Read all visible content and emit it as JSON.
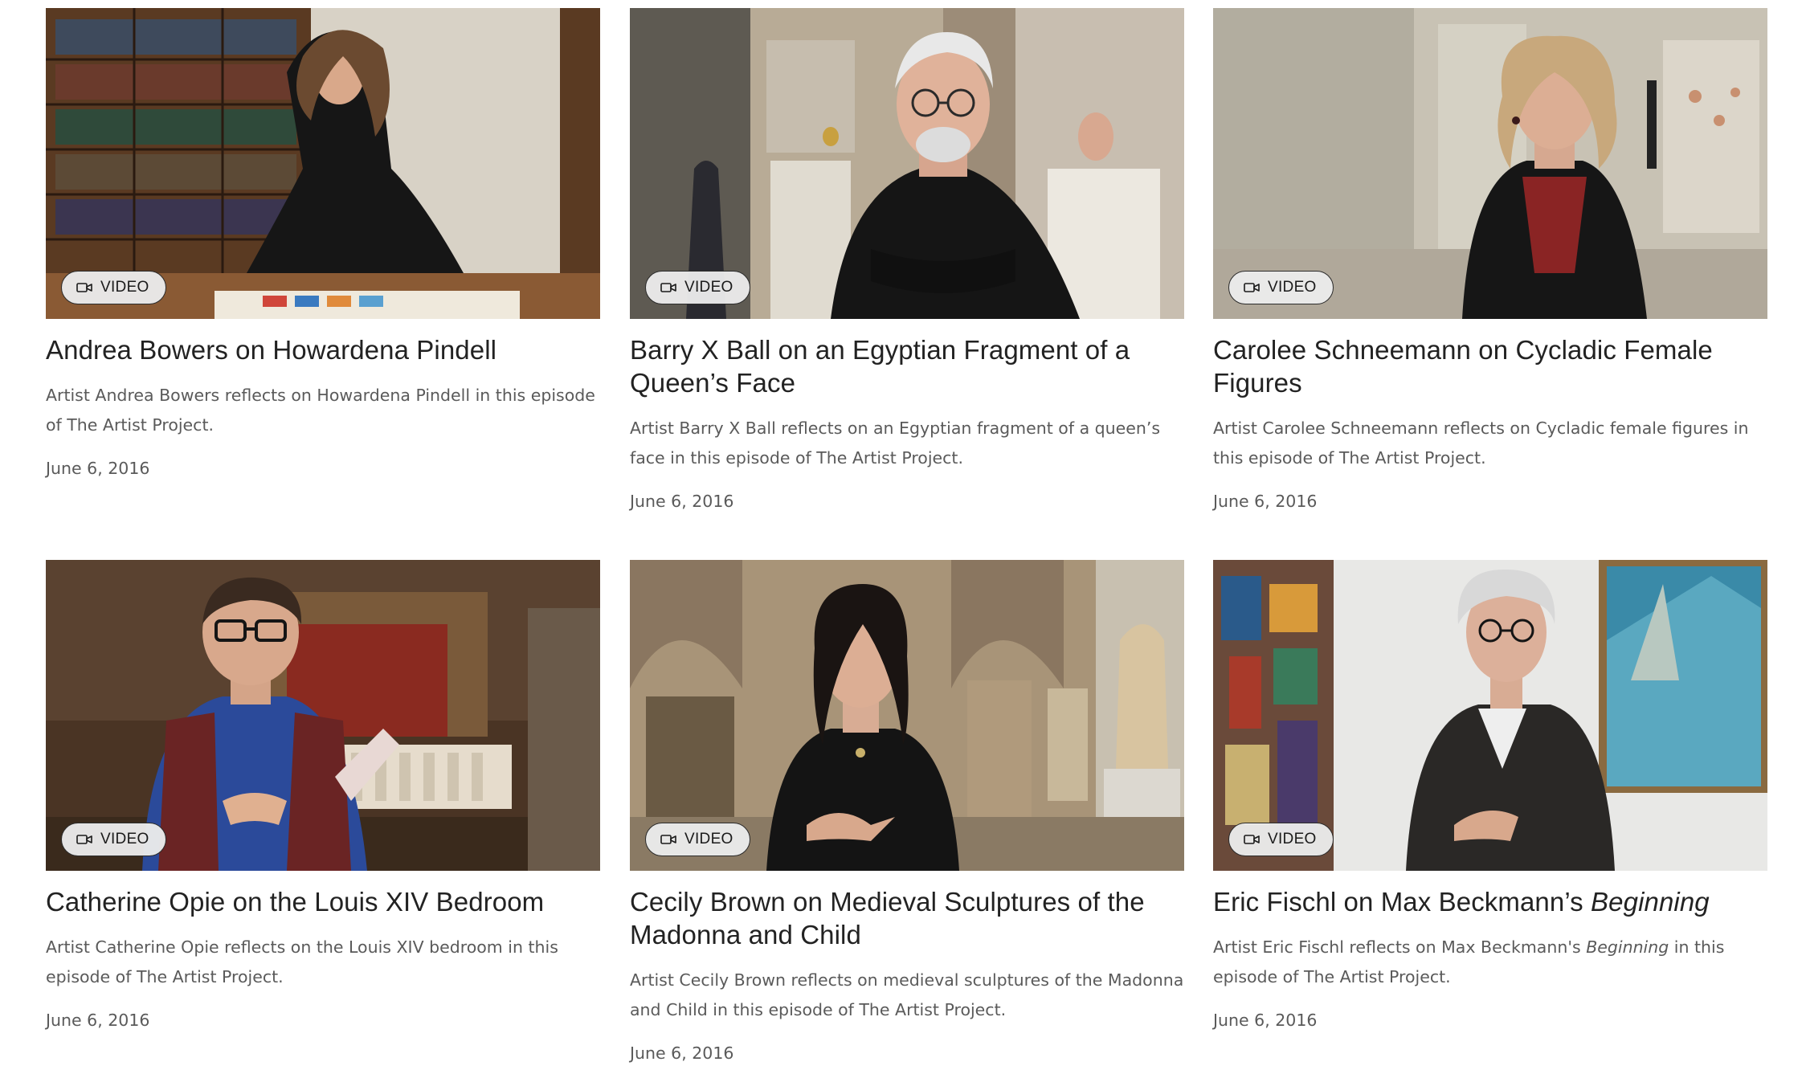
{
  "badge_label": "VIDEO",
  "cards": [
    {
      "title": "Andrea Bowers on Howardena Pindell",
      "title_italic": "",
      "desc_before": "Artist Andrea Bowers reflects on Howardena Pindell in this episode of The Artist Project.",
      "desc_italic": "",
      "desc_after": "",
      "date": "June 6, 2016"
    },
    {
      "title": "Barry X Ball on an Egyptian Fragment of a Queen’s Face",
      "title_italic": "",
      "desc_before": "Artist Barry X Ball reflects on an Egyptian fragment of a queen’s face in this episode of The Artist Project.",
      "desc_italic": "",
      "desc_after": "",
      "date": "June 6, 2016"
    },
    {
      "title": "Carolee Schneemann on Cycladic Female Figures",
      "title_italic": "",
      "desc_before": "Artist Carolee Schneemann reflects on Cycladic female figures in this episode of The Artist Project.",
      "desc_italic": "",
      "desc_after": "",
      "date": "June 6, 2016"
    },
    {
      "title": "Catherine Opie on the Louis XIV Bedroom",
      "title_italic": "",
      "desc_before": "Artist Catherine Opie reflects on the Louis XIV bedroom in this episode of The Artist Project.",
      "desc_italic": "",
      "desc_after": "",
      "date": "June 6, 2016"
    },
    {
      "title": "Cecily Brown on Medieval Sculptures of the Madonna and Child",
      "title_italic": "",
      "desc_before": "Artist Cecily Brown reflects on medieval sculptures of the Madonna and Child in this episode of The Artist Project.",
      "desc_italic": "",
      "desc_after": "",
      "date": "June 6, 2016"
    },
    {
      "title": "Eric Fischl on Max Beckmann’s ",
      "title_italic": "Beginning",
      "desc_before": "Artist Eric Fischl reflects on Max Beckmann's ",
      "desc_italic": "Beginning",
      "desc_after": " in this episode of The Artist Project.",
      "date": "June 6, 2016"
    }
  ]
}
